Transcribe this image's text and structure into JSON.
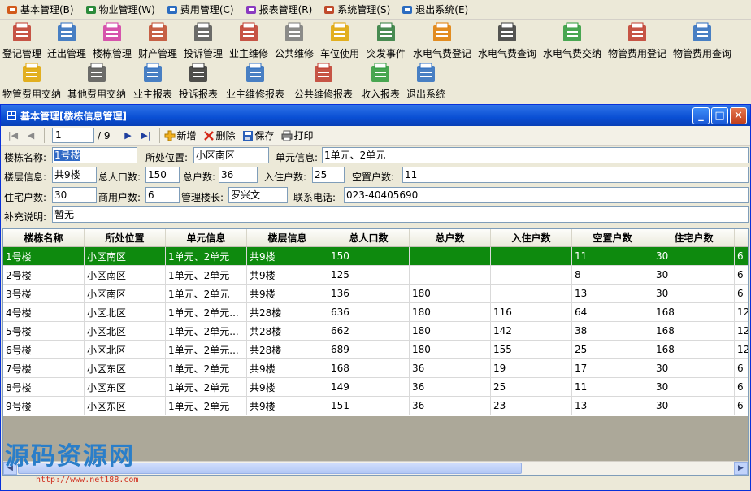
{
  "menu": [
    {
      "label": "基本管理(B)",
      "icon": "basic-icon"
    },
    {
      "label": "物业管理(W)",
      "icon": "property-icon"
    },
    {
      "label": "费用管理(C)",
      "icon": "fee-icon"
    },
    {
      "label": "报表管理(R)",
      "icon": "report-icon"
    },
    {
      "label": "系统管理(S)",
      "icon": "system-icon"
    },
    {
      "label": "退出系统(E)",
      "icon": "exit-icon"
    }
  ],
  "toolbar_row1": [
    {
      "label": "登记管理",
      "icon": "register-icon",
      "color": "#c0392b"
    },
    {
      "label": "迁出管理",
      "icon": "moveout-icon",
      "color": "#2b6cc0"
    },
    {
      "label": "楼栋管理",
      "icon": "building-icon",
      "color": "#d23aa5"
    },
    {
      "label": "财产管理",
      "icon": "house-icon",
      "color": "#c0482b"
    },
    {
      "label": "投诉管理",
      "icon": "complaint-icon",
      "color": "#555555"
    },
    {
      "label": "业主维修",
      "icon": "owner-repair-icon",
      "color": "#c0392b"
    },
    {
      "label": "公共维修",
      "icon": "public-repair-icon",
      "color": "#7a7a7a"
    },
    {
      "label": "车位使用",
      "icon": "parking-icon",
      "color": "#e0a400"
    },
    {
      "label": "突发事件",
      "icon": "emergency-icon",
      "color": "#2c7a3a"
    },
    {
      "label": "水电气费登记",
      "icon": "utility-register-icon",
      "color": "#e07b00"
    },
    {
      "label": "水电气费查询",
      "icon": "utility-query-icon",
      "color": "#3a3a3a"
    },
    {
      "label": "水电气费交纳",
      "icon": "utility-pay-icon",
      "color": "#2b9a3a"
    },
    {
      "label": "物管费用登记",
      "icon": "mgmt-fee-register-icon",
      "color": "#c0392b"
    },
    {
      "label": "物管费用查询",
      "icon": "mgmt-fee-query-icon",
      "color": "#2b6cc0"
    }
  ],
  "toolbar_row2": [
    {
      "label": "物管费用交纳",
      "icon": "mgmt-fee-pay-icon",
      "color": "#e0a400"
    },
    {
      "label": "其他费用交纳",
      "icon": "other-fee-icon",
      "color": "#555555"
    },
    {
      "label": "业主报表",
      "icon": "owner-report-icon",
      "color": "#2b6cc0"
    },
    {
      "label": "投诉报表",
      "icon": "complaint-report-icon",
      "color": "#333333"
    },
    {
      "label": "业主维修报表",
      "icon": "owner-repair-report-icon",
      "color": "#2b6cc0"
    },
    {
      "label": "公共维修报表",
      "icon": "public-repair-report-icon",
      "color": "#c0392b"
    },
    {
      "label": "收入报表",
      "icon": "income-report-icon",
      "color": "#2b9a3a"
    },
    {
      "label": "退出系统",
      "icon": "exit-system-icon",
      "color": "#2b6cc0"
    }
  ],
  "window": {
    "title": "基本管理[楼栋信息管理]",
    "controls": [
      "minimize-icon",
      "maximize-icon",
      "close-icon"
    ]
  },
  "navigator": {
    "position": "1",
    "total": "/ 9",
    "add_label": "新增",
    "delete_label": "删除",
    "save_label": "保存",
    "print_label": "打印"
  },
  "form": {
    "name_label": "楼栋名称:",
    "name_value": "1号楼",
    "location_label": "所处位置:",
    "location_value": "小区南区",
    "unit_label": "单元信息:",
    "unit_value": "1单元、2单元",
    "floor_label": "楼层信息:",
    "floor_value": "共9楼",
    "population_label": "总人口数:",
    "population_value": "150",
    "households_label": "总户数:",
    "households_value": "36",
    "occupied_label": "入住户数:",
    "occupied_value": "25",
    "vacant_label": "空置户数:",
    "vacant_value": "11",
    "residential_label": "住宅户数:",
    "residential_value": "30",
    "commercial_label": "商用户数:",
    "commercial_value": "6",
    "manager_label": "管理楼长:",
    "manager_value": "罗兴文",
    "phone_label": "联系电话:",
    "phone_value": "023-40405690",
    "note_label": "补充说明:",
    "note_value": "暂无"
  },
  "grid": {
    "columns": [
      "楼栋名称",
      "所处位置",
      "单元信息",
      "楼层信息",
      "总人口数",
      "总户数",
      "入住户数",
      "空置户数",
      "住宅户数"
    ],
    "rows": [
      [
        "1号楼",
        "小区南区",
        "1单元、2单元",
        "共9楼",
        "150",
        "",
        "",
        "11",
        "30",
        "6"
      ],
      [
        "2号楼",
        "小区南区",
        "1单元、2单元",
        "共9楼",
        "125",
        "",
        "",
        "8",
        "30",
        "6"
      ],
      [
        "3号楼",
        "小区南区",
        "1单元、2单元",
        "共9楼",
        "136",
        "180",
        "",
        "13",
        "30",
        "6"
      ],
      [
        "4号楼",
        "小区北区",
        "1单元、2单元...",
        "共28楼",
        "636",
        "180",
        "116",
        "64",
        "168",
        "12"
      ],
      [
        "5号楼",
        "小区北区",
        "1单元、2单元...",
        "共28楼",
        "662",
        "180",
        "142",
        "38",
        "168",
        "12"
      ],
      [
        "6号楼",
        "小区北区",
        "1单元、2单元...",
        "共28楼",
        "689",
        "180",
        "155",
        "25",
        "168",
        "12"
      ],
      [
        "7号楼",
        "小区东区",
        "1单元、2单元",
        "共9楼",
        "168",
        "36",
        "19",
        "17",
        "30",
        "6"
      ],
      [
        "8号楼",
        "小区东区",
        "1单元、2单元",
        "共9楼",
        "149",
        "36",
        "25",
        "11",
        "30",
        "6"
      ],
      [
        "9号楼",
        "小区东区",
        "1单元、2单元",
        "共9楼",
        "151",
        "36",
        "23",
        "13",
        "30",
        "6"
      ]
    ],
    "selected_row": 0,
    "selected_color": "#0e8a0e"
  },
  "watermark": {
    "text": "源码资源网",
    "url": "http://www.net188.com"
  }
}
